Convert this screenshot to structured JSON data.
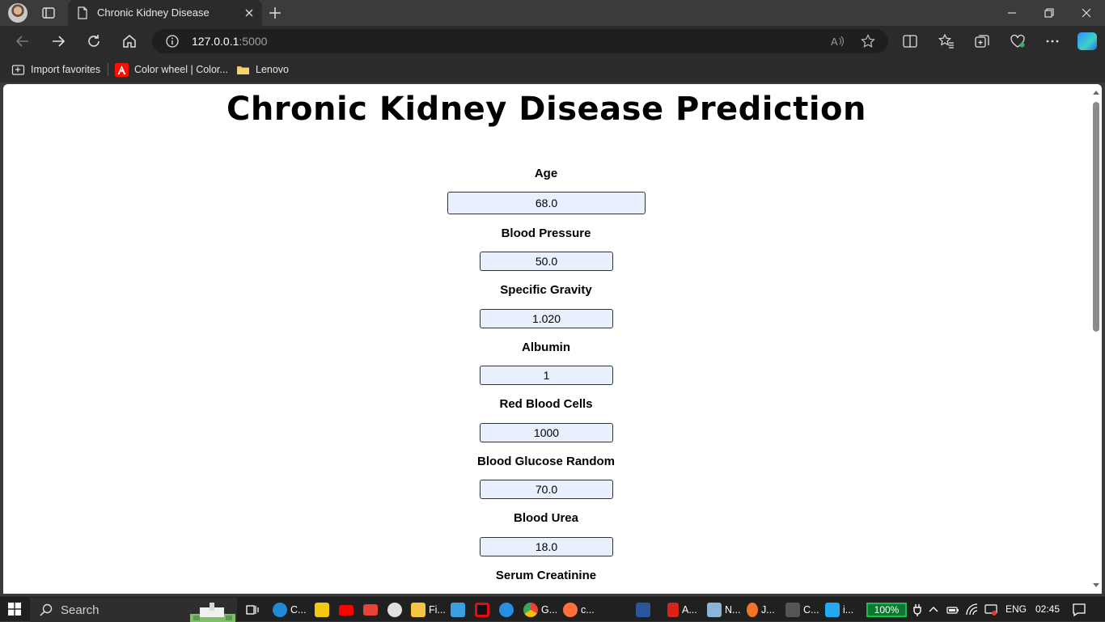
{
  "browser": {
    "tab": {
      "title": "Chronic Kidney Disease"
    },
    "address": {
      "host": "127.0.0.1",
      "port": ":5000"
    },
    "favorites": [
      {
        "label": "Import favorites",
        "icon": "import-favorites-icon"
      },
      {
        "label": "Color wheel | Color...",
        "icon": "adobe-icon"
      },
      {
        "label": "Lenovo",
        "icon": "folder-icon"
      }
    ]
  },
  "page": {
    "title": "Chronic Kidney Disease Prediction",
    "fields": [
      {
        "label": "Age",
        "value": "68.0"
      },
      {
        "label": "Blood Pressure",
        "value": "50.0"
      },
      {
        "label": "Specific Gravity",
        "value": "1.020"
      },
      {
        "label": "Albumin",
        "value": "1"
      },
      {
        "label": "Red Blood Cells",
        "value": "1000"
      },
      {
        "label": "Blood Glucose Random",
        "value": "70.0"
      },
      {
        "label": "Blood Urea",
        "value": "18.0"
      },
      {
        "label": "Serum Creatinine",
        "value": ""
      }
    ]
  },
  "taskbar": {
    "search_label": "Search",
    "apps": [
      {
        "label": "C...",
        "icon": "edge-icon",
        "color": "#1f8ad6"
      },
      {
        "label": "",
        "icon": "store-icon",
        "color": "#f2c811"
      },
      {
        "label": "",
        "icon": "youtube-icon",
        "color": "#ff0000"
      },
      {
        "label": "",
        "icon": "gmail-icon",
        "color": "#ea4335"
      },
      {
        "label": "",
        "icon": "chrome-app-icon",
        "color": "#e0e0e0"
      },
      {
        "label": "Fi...",
        "icon": "file-explorer-icon",
        "color": "#f4c542"
      },
      {
        "label": "",
        "icon": "remote-desktop-icon",
        "color": "#3aa0e0"
      },
      {
        "label": "",
        "icon": "netflix-icon",
        "color": "#e50914"
      },
      {
        "label": "",
        "icon": "internet-explorer-icon",
        "color": "#2a8ee0"
      },
      {
        "label": "G...",
        "icon": "chrome-icon",
        "color": "#34a853"
      },
      {
        "label": "c...",
        "icon": "firefox-icon",
        "color": "#ff7139"
      },
      {
        "label": "",
        "icon": "word-icon",
        "color": "#2b579a"
      },
      {
        "label": "A...",
        "icon": "acrobat-icon",
        "color": "#d9241b"
      },
      {
        "label": "N...",
        "icon": "notepad-icon",
        "color": "#8ab4d8"
      },
      {
        "label": "J...",
        "icon": "jupyter-icon",
        "color": "#f37626"
      },
      {
        "label": "C...",
        "icon": "terminal-icon",
        "color": "#555555"
      },
      {
        "label": "i...",
        "icon": "vscode-icon",
        "color": "#23a9f2"
      }
    ],
    "battery": "100%",
    "language": "ENG",
    "time": "02:45"
  }
}
